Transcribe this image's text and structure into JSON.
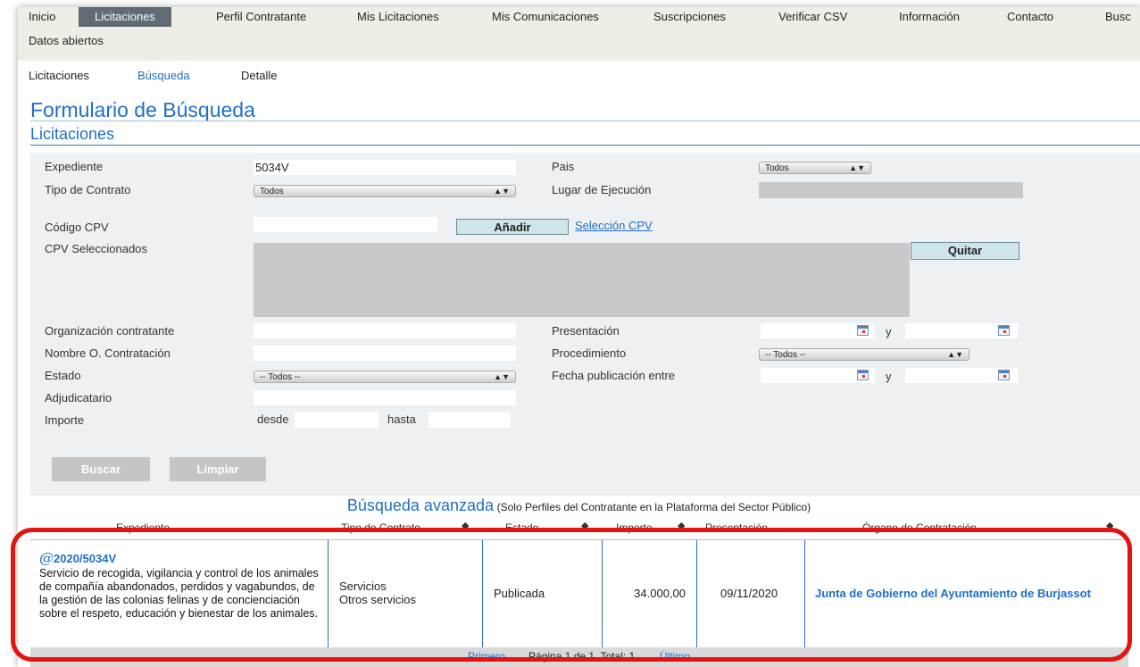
{
  "topnav": {
    "items": [
      "Inicio",
      "Licitaciones",
      "Perfil Contratante",
      "Mis Licitaciones",
      "Mis Comunicaciones",
      "Suscripciones",
      "Verificar CSV",
      "Información",
      "Contacto",
      "Busc"
    ],
    "second_row": "Datos abiertos"
  },
  "subnav": {
    "items": [
      "Licitaciones",
      "Búsqueda",
      "Detalle"
    ]
  },
  "page_title": "Formulario de Búsqueda",
  "section_title": "Licitaciones",
  "form": {
    "expediente_label": "Expediente",
    "expediente_value": "5034V",
    "tipo_contrato_label": "Tipo de Contrato",
    "tipo_contrato_value": "Todos",
    "pais_label": "Pais",
    "pais_value": "Todos",
    "lugar_label": "Lugar de Ejecución",
    "cpv_label": "Código CPV",
    "anadir_label": "Añadir",
    "seleccion_cpv_label": "Selección CPV",
    "cpv_sel_label": "CPV Seleccionados",
    "quitar_label": "Quitar",
    "org_label": "Organización contratante",
    "nombre_org_label": "Nombre O. Contratación",
    "estado_label": "Estado",
    "estado_value": "-- Todos --",
    "adjudicatario_label": "Adjudicatario",
    "importe_label": "Importe",
    "desde_label": "desde",
    "hasta_label": "hasta",
    "presentacion_label": "Presentación",
    "procedimiento_label": "Procedimiento",
    "procedimiento_value": "-- Todos --",
    "fecha_pub_label": "Fecha publicación entre",
    "y_label": "y",
    "buscar_label": "Buscar",
    "limpiar_label": "Limpiar"
  },
  "advanced": {
    "title": "Búsqueda avanzada",
    "note": "(Solo Perfiles del Contratante en la Plataforma del Sector Público)"
  },
  "table": {
    "headers": [
      "Expediente",
      "Tipo de Contrato",
      "Estado",
      "Importe",
      "Presentación",
      "Órgano de Contratación"
    ],
    "row": {
      "expediente": "2020/5034V",
      "descripcion": "Servicio de recogida, vigilancia y control de los animales de compañía abandonados, perdidos y vagabundos, de la gestión de las colonias felinas y de concienciación sobre el respeto, educación y bienestar de los animales.",
      "tipo_1": "Servicios",
      "tipo_2": "Otros servicios",
      "estado": "Publicada",
      "importe": "34.000,00",
      "presentacion": "09/11/2020",
      "organo": "Junta de Gobierno del Ayuntamiento de Burjassot"
    }
  },
  "pager": {
    "first": "Primero",
    "info": "Página 1 de 1. Total: 1",
    "last": "Último"
  },
  "colors": {
    "accent": "#1e6fc7",
    "highlight": "#e3140f",
    "nav_active": "#606b74"
  }
}
